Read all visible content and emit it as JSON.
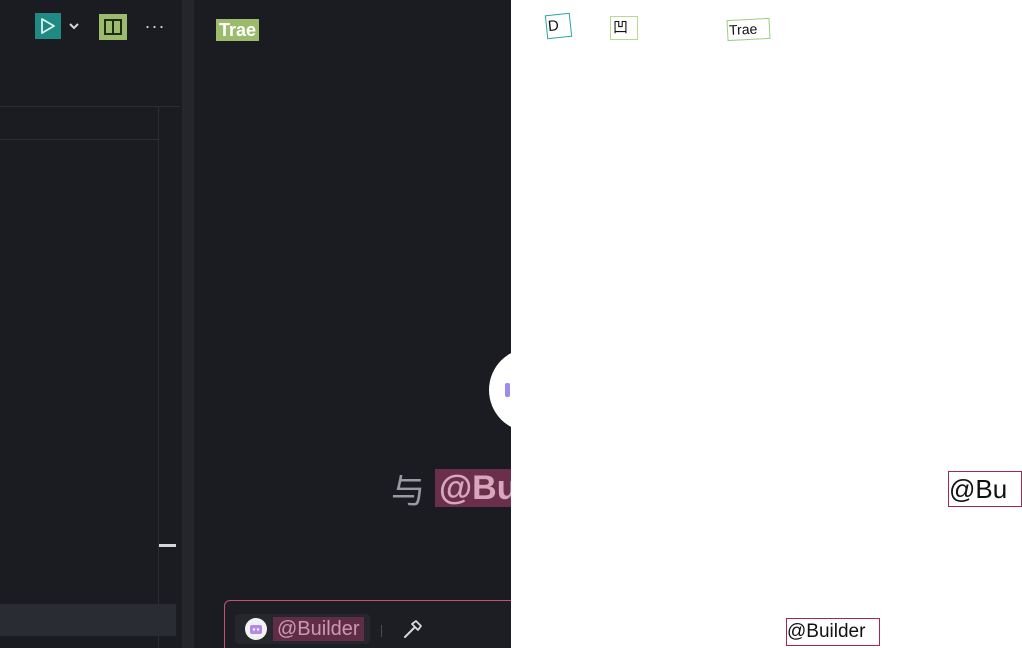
{
  "toolbar": {
    "run_icon": "play-icon",
    "run_dropdown_icon": "chevron-down-icon",
    "layout_icon": "split-layout-icon",
    "more_icon": "more-horizontal-icon",
    "more_glyph": "···"
  },
  "chat_panel": {
    "title": "Trae",
    "greeting_prefix": "与",
    "greeting_agent": "@Bu",
    "agent_name": "@Builder",
    "tools_icon": "hammer-icon"
  },
  "annotations": {
    "run_box_text": "D",
    "layout_box_text": "凹",
    "title_box_text": "Trae",
    "greeting_box_text": "@Bu",
    "agent_box_text": "@Builder"
  },
  "colors": {
    "panel_bg": "#1b1c21",
    "run_button": "#1f8a84",
    "layout_button": "#9dbb6c",
    "title_highlight": "#9dbb6c",
    "agent_highlight": "#6a2f4b",
    "chat_border": "#c4536f",
    "loader_accent": "#9a8cf0"
  }
}
